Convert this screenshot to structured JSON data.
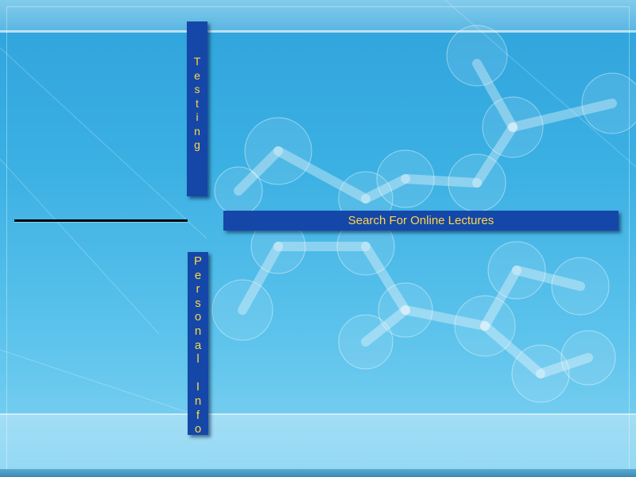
{
  "nav": {
    "testing": {
      "label": "Testing",
      "letters": [
        "T",
        "e",
        "s",
        "t",
        "i",
        "n",
        "g"
      ]
    },
    "personal_info": {
      "label": "Personal Info",
      "letters": [
        "P",
        "e",
        "r",
        "s",
        "o",
        "n",
        "a",
        "l",
        "",
        "I",
        "n",
        "f",
        "o"
      ]
    },
    "search_lectures": {
      "label": "Search For Online Lectures"
    }
  },
  "colors": {
    "nav_bar": "#1547a8",
    "nav_text": "#ffd64a",
    "background": "#3bb0e3"
  }
}
